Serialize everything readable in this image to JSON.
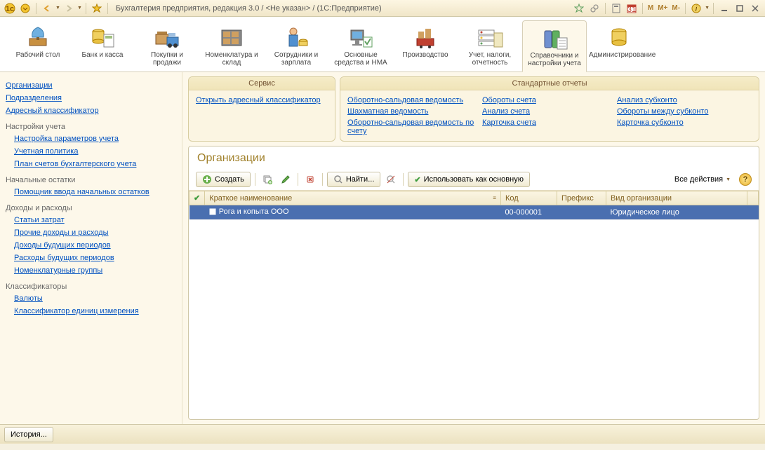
{
  "title": "Бухгалтерия предприятия, редакция 3.0 / <Не указан> / (1С:Предприятие)",
  "title_m": [
    "M",
    "M+",
    "M-"
  ],
  "sections": [
    {
      "label": "Рабочий стол"
    },
    {
      "label": "Банк и касса"
    },
    {
      "label": "Покупки и продажи"
    },
    {
      "label": "Номенклатура и склад"
    },
    {
      "label": "Сотрудники и зарплата"
    },
    {
      "label": "Основные средства и НМА"
    },
    {
      "label": "Производство"
    },
    {
      "label": "Учет, налоги, отчетность"
    },
    {
      "label": "Справочники и настройки учета"
    },
    {
      "label": "Администрирование"
    }
  ],
  "sidebar": {
    "top": [
      "Организации",
      "Подразделения",
      "Адресный классификатор"
    ],
    "groups": [
      {
        "title": "Настройки учета",
        "items": [
          "Настройка параметров учета",
          "Учетная политика",
          "План счетов бухгалтерского учета"
        ]
      },
      {
        "title": "Начальные остатки",
        "items": [
          "Помощник ввода начальных остатков"
        ]
      },
      {
        "title": "Доходы и расходы",
        "items": [
          "Статьи затрат",
          "Прочие доходы и расходы",
          "Доходы будущих периодов",
          "Расходы будущих периодов",
          "Номенклатурные группы"
        ]
      },
      {
        "title": "Классификаторы",
        "items": [
          "Валюты",
          "Классификатор единиц измерения"
        ]
      }
    ]
  },
  "panels": {
    "service": {
      "title": "Сервис",
      "cols": [
        [
          "Открыть адресный классификатор"
        ]
      ]
    },
    "reports": {
      "title": "Стандартные отчеты",
      "cols": [
        [
          "Оборотно-сальдовая ведомость",
          "Шахматная ведомость",
          "Оборотно-сальдовая ведомость по счету"
        ],
        [
          "Обороты счета",
          "Анализ счета",
          "Карточка счета"
        ],
        [
          "Анализ субконто",
          "Обороты между субконто",
          "Карточка субконто"
        ]
      ]
    }
  },
  "page": {
    "title": "Организации",
    "toolbar": {
      "create": "Создать",
      "find": "Найти...",
      "use_main": "Использовать как основную",
      "all_actions": "Все действия"
    },
    "columns": [
      "",
      "Краткое наименование",
      "Код",
      "Префикс",
      "Вид организации"
    ],
    "rows": [
      {
        "name": "Рога и копыта ООО",
        "code": "00-000001",
        "prefix": "",
        "type": "Юридическое лицо"
      }
    ]
  },
  "footer": {
    "history": "История..."
  }
}
